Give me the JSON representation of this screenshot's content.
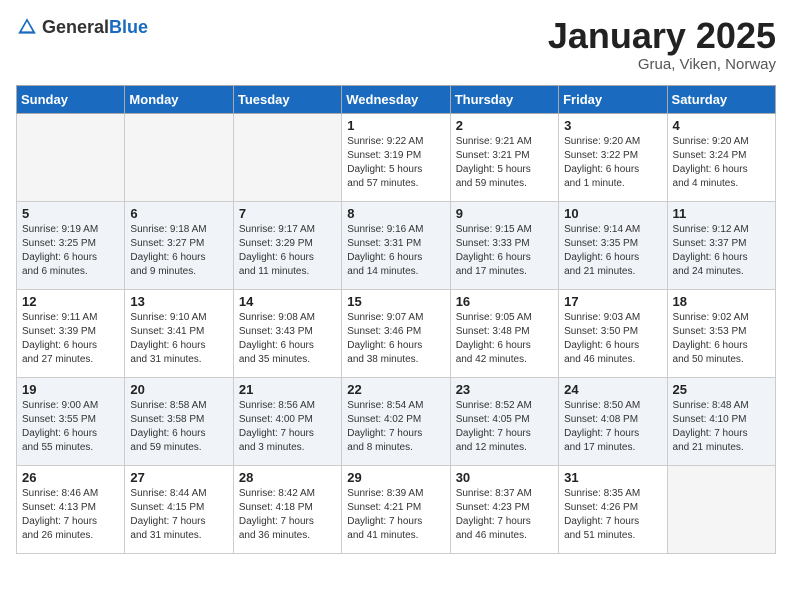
{
  "header": {
    "logo_general": "General",
    "logo_blue": "Blue",
    "title": "January 2025",
    "location": "Grua, Viken, Norway"
  },
  "weekdays": [
    "Sunday",
    "Monday",
    "Tuesday",
    "Wednesday",
    "Thursday",
    "Friday",
    "Saturday"
  ],
  "weeks": [
    {
      "rowClass": "week-row-0",
      "days": [
        {
          "num": "",
          "empty": true
        },
        {
          "num": "",
          "empty": true
        },
        {
          "num": "",
          "empty": true
        },
        {
          "num": "1",
          "empty": false,
          "detail": "Sunrise: 9:22 AM\nSunset: 3:19 PM\nDaylight: 5 hours\nand 57 minutes."
        },
        {
          "num": "2",
          "empty": false,
          "detail": "Sunrise: 9:21 AM\nSunset: 3:21 PM\nDaylight: 5 hours\nand 59 minutes."
        },
        {
          "num": "3",
          "empty": false,
          "detail": "Sunrise: 9:20 AM\nSunset: 3:22 PM\nDaylight: 6 hours\nand 1 minute."
        },
        {
          "num": "4",
          "empty": false,
          "detail": "Sunrise: 9:20 AM\nSunset: 3:24 PM\nDaylight: 6 hours\nand 4 minutes."
        }
      ]
    },
    {
      "rowClass": "week-row-1",
      "days": [
        {
          "num": "5",
          "empty": false,
          "detail": "Sunrise: 9:19 AM\nSunset: 3:25 PM\nDaylight: 6 hours\nand 6 minutes."
        },
        {
          "num": "6",
          "empty": false,
          "detail": "Sunrise: 9:18 AM\nSunset: 3:27 PM\nDaylight: 6 hours\nand 9 minutes."
        },
        {
          "num": "7",
          "empty": false,
          "detail": "Sunrise: 9:17 AM\nSunset: 3:29 PM\nDaylight: 6 hours\nand 11 minutes."
        },
        {
          "num": "8",
          "empty": false,
          "detail": "Sunrise: 9:16 AM\nSunset: 3:31 PM\nDaylight: 6 hours\nand 14 minutes."
        },
        {
          "num": "9",
          "empty": false,
          "detail": "Sunrise: 9:15 AM\nSunset: 3:33 PM\nDaylight: 6 hours\nand 17 minutes."
        },
        {
          "num": "10",
          "empty": false,
          "detail": "Sunrise: 9:14 AM\nSunset: 3:35 PM\nDaylight: 6 hours\nand 21 minutes."
        },
        {
          "num": "11",
          "empty": false,
          "detail": "Sunrise: 9:12 AM\nSunset: 3:37 PM\nDaylight: 6 hours\nand 24 minutes."
        }
      ]
    },
    {
      "rowClass": "week-row-2",
      "days": [
        {
          "num": "12",
          "empty": false,
          "detail": "Sunrise: 9:11 AM\nSunset: 3:39 PM\nDaylight: 6 hours\nand 27 minutes."
        },
        {
          "num": "13",
          "empty": false,
          "detail": "Sunrise: 9:10 AM\nSunset: 3:41 PM\nDaylight: 6 hours\nand 31 minutes."
        },
        {
          "num": "14",
          "empty": false,
          "detail": "Sunrise: 9:08 AM\nSunset: 3:43 PM\nDaylight: 6 hours\nand 35 minutes."
        },
        {
          "num": "15",
          "empty": false,
          "detail": "Sunrise: 9:07 AM\nSunset: 3:46 PM\nDaylight: 6 hours\nand 38 minutes."
        },
        {
          "num": "16",
          "empty": false,
          "detail": "Sunrise: 9:05 AM\nSunset: 3:48 PM\nDaylight: 6 hours\nand 42 minutes."
        },
        {
          "num": "17",
          "empty": false,
          "detail": "Sunrise: 9:03 AM\nSunset: 3:50 PM\nDaylight: 6 hours\nand 46 minutes."
        },
        {
          "num": "18",
          "empty": false,
          "detail": "Sunrise: 9:02 AM\nSunset: 3:53 PM\nDaylight: 6 hours\nand 50 minutes."
        }
      ]
    },
    {
      "rowClass": "week-row-3",
      "days": [
        {
          "num": "19",
          "empty": false,
          "detail": "Sunrise: 9:00 AM\nSunset: 3:55 PM\nDaylight: 6 hours\nand 55 minutes."
        },
        {
          "num": "20",
          "empty": false,
          "detail": "Sunrise: 8:58 AM\nSunset: 3:58 PM\nDaylight: 6 hours\nand 59 minutes."
        },
        {
          "num": "21",
          "empty": false,
          "detail": "Sunrise: 8:56 AM\nSunset: 4:00 PM\nDaylight: 7 hours\nand 3 minutes."
        },
        {
          "num": "22",
          "empty": false,
          "detail": "Sunrise: 8:54 AM\nSunset: 4:02 PM\nDaylight: 7 hours\nand 8 minutes."
        },
        {
          "num": "23",
          "empty": false,
          "detail": "Sunrise: 8:52 AM\nSunset: 4:05 PM\nDaylight: 7 hours\nand 12 minutes."
        },
        {
          "num": "24",
          "empty": false,
          "detail": "Sunrise: 8:50 AM\nSunset: 4:08 PM\nDaylight: 7 hours\nand 17 minutes."
        },
        {
          "num": "25",
          "empty": false,
          "detail": "Sunrise: 8:48 AM\nSunset: 4:10 PM\nDaylight: 7 hours\nand 21 minutes."
        }
      ]
    },
    {
      "rowClass": "week-row-4",
      "days": [
        {
          "num": "26",
          "empty": false,
          "detail": "Sunrise: 8:46 AM\nSunset: 4:13 PM\nDaylight: 7 hours\nand 26 minutes."
        },
        {
          "num": "27",
          "empty": false,
          "detail": "Sunrise: 8:44 AM\nSunset: 4:15 PM\nDaylight: 7 hours\nand 31 minutes."
        },
        {
          "num": "28",
          "empty": false,
          "detail": "Sunrise: 8:42 AM\nSunset: 4:18 PM\nDaylight: 7 hours\nand 36 minutes."
        },
        {
          "num": "29",
          "empty": false,
          "detail": "Sunrise: 8:39 AM\nSunset: 4:21 PM\nDaylight: 7 hours\nand 41 minutes."
        },
        {
          "num": "30",
          "empty": false,
          "detail": "Sunrise: 8:37 AM\nSunset: 4:23 PM\nDaylight: 7 hours\nand 46 minutes."
        },
        {
          "num": "31",
          "empty": false,
          "detail": "Sunrise: 8:35 AM\nSunset: 4:26 PM\nDaylight: 7 hours\nand 51 minutes."
        },
        {
          "num": "",
          "empty": true
        }
      ]
    }
  ]
}
